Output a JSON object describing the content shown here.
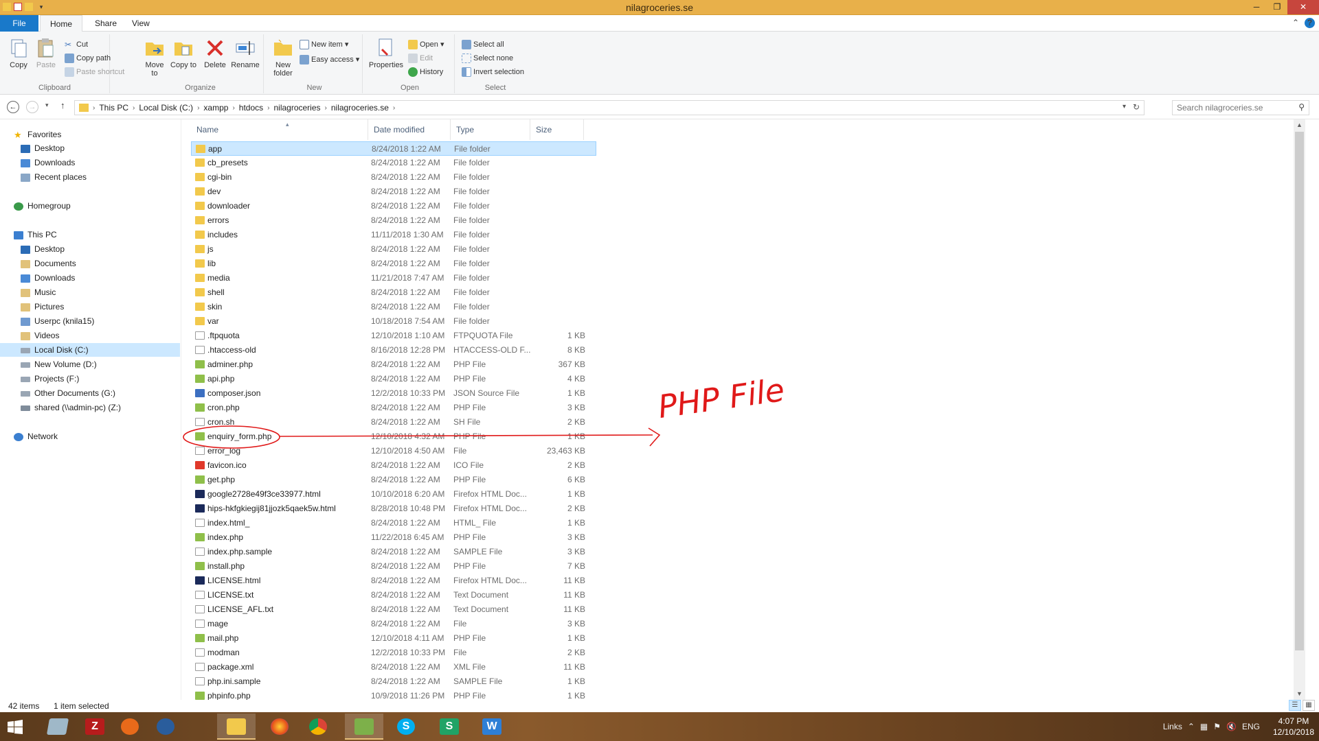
{
  "window": {
    "title": "nilagroceries.se",
    "minimize_glyph": "─",
    "restore_glyph": "❐",
    "close_glyph": "✕"
  },
  "ribbon_tabs": [
    "File",
    "Home",
    "Share",
    "View"
  ],
  "ribbon": {
    "clipboard": {
      "label": "Clipboard",
      "copy": "Copy",
      "paste": "Paste",
      "cut": "Cut",
      "copy_path": "Copy path",
      "paste_shortcut": "Paste shortcut"
    },
    "organize": {
      "label": "Organize",
      "move_to": "Move to",
      "copy_to": "Copy to",
      "delete": "Delete",
      "rename": "Rename"
    },
    "new": {
      "label": "New",
      "new_folder": "New folder",
      "new_item": "New item",
      "easy_access": "Easy access"
    },
    "open": {
      "label": "Open",
      "properties": "Properties",
      "open": "Open",
      "edit": "Edit",
      "history": "History"
    },
    "select": {
      "label": "Select",
      "select_all": "Select all",
      "select_none": "Select none",
      "invert_selection": "Invert selection"
    }
  },
  "address": {
    "crumbs": [
      "This PC",
      "Local Disk (C:)",
      "xampp",
      "htdocs",
      "nilagroceries",
      "nilagroceries.se"
    ],
    "search_placeholder": "Search nilagroceries.se"
  },
  "nav": {
    "favorites": {
      "label": "Favorites",
      "items": [
        "Desktop",
        "Downloads",
        "Recent places"
      ]
    },
    "homegroup": "Homegroup",
    "this_pc": {
      "label": "This PC",
      "items": [
        "Desktop",
        "Documents",
        "Downloads",
        "Music",
        "Pictures",
        "Userpc (knila15)",
        "Videos",
        "Local Disk (C:)",
        "New Volume (D:)",
        "Projects (F:)",
        "Other Documents (G:)",
        "shared (\\\\admin-pc) (Z:)"
      ]
    },
    "network": "Network"
  },
  "columns": {
    "name": "Name",
    "date": "Date modified",
    "type": "Type",
    "size": "Size"
  },
  "files": [
    {
      "name": "app",
      "date": "8/24/2018 1:22 AM",
      "type": "File folder",
      "size": "",
      "icon": "folder",
      "selected": true
    },
    {
      "name": "cb_presets",
      "date": "8/24/2018 1:22 AM",
      "type": "File folder",
      "size": "",
      "icon": "folder"
    },
    {
      "name": "cgi-bin",
      "date": "8/24/2018 1:22 AM",
      "type": "File folder",
      "size": "",
      "icon": "folder"
    },
    {
      "name": "dev",
      "date": "8/24/2018 1:22 AM",
      "type": "File folder",
      "size": "",
      "icon": "folder"
    },
    {
      "name": "downloader",
      "date": "8/24/2018 1:22 AM",
      "type": "File folder",
      "size": "",
      "icon": "folder"
    },
    {
      "name": "errors",
      "date": "8/24/2018 1:22 AM",
      "type": "File folder",
      "size": "",
      "icon": "folder"
    },
    {
      "name": "includes",
      "date": "11/11/2018 1:30 AM",
      "type": "File folder",
      "size": "",
      "icon": "folder"
    },
    {
      "name": "js",
      "date": "8/24/2018 1:22 AM",
      "type": "File folder",
      "size": "",
      "icon": "folder"
    },
    {
      "name": "lib",
      "date": "8/24/2018 1:22 AM",
      "type": "File folder",
      "size": "",
      "icon": "folder"
    },
    {
      "name": "media",
      "date": "11/21/2018 7:47 AM",
      "type": "File folder",
      "size": "",
      "icon": "folder"
    },
    {
      "name": "shell",
      "date": "8/24/2018 1:22 AM",
      "type": "File folder",
      "size": "",
      "icon": "folder"
    },
    {
      "name": "skin",
      "date": "8/24/2018 1:22 AM",
      "type": "File folder",
      "size": "",
      "icon": "folder"
    },
    {
      "name": "var",
      "date": "10/18/2018 7:54 AM",
      "type": "File folder",
      "size": "",
      "icon": "folder"
    },
    {
      "name": ".ftpquota",
      "date": "12/10/2018 1:10 AM",
      "type": "FTPQUOTA File",
      "size": "1 KB",
      "icon": "blank"
    },
    {
      "name": ".htaccess-old",
      "date": "8/16/2018 12:28 PM",
      "type": "HTACCESS-OLD F...",
      "size": "8 KB",
      "icon": "blank"
    },
    {
      "name": "adminer.php",
      "date": "8/24/2018 1:22 AM",
      "type": "PHP File",
      "size": "367 KB",
      "icon": "php"
    },
    {
      "name": "api.php",
      "date": "8/24/2018 1:22 AM",
      "type": "PHP File",
      "size": "4 KB",
      "icon": "php"
    },
    {
      "name": "composer.json",
      "date": "12/2/2018 10:33 PM",
      "type": "JSON Source File",
      "size": "1 KB",
      "icon": "json"
    },
    {
      "name": "cron.php",
      "date": "8/24/2018 1:22 AM",
      "type": "PHP File",
      "size": "3 KB",
      "icon": "php"
    },
    {
      "name": "cron.sh",
      "date": "8/24/2018 1:22 AM",
      "type": "SH File",
      "size": "2 KB",
      "icon": "blank"
    },
    {
      "name": "enquiry_form.php",
      "date": "12/10/2018 4:32 AM",
      "type": "PHP File",
      "size": "1 KB",
      "icon": "php"
    },
    {
      "name": "error_log",
      "date": "12/10/2018 4:50 AM",
      "type": "File",
      "size": "23,463 KB",
      "icon": "blank"
    },
    {
      "name": "favicon.ico",
      "date": "8/24/2018 1:22 AM",
      "type": "ICO File",
      "size": "2 KB",
      "icon": "ico"
    },
    {
      "name": "get.php",
      "date": "8/24/2018 1:22 AM",
      "type": "PHP File",
      "size": "6 KB",
      "icon": "php"
    },
    {
      "name": "google2728e49f3ce33977.html",
      "date": "10/10/2018 6:20 AM",
      "type": "Firefox HTML Doc...",
      "size": "1 KB",
      "icon": "html"
    },
    {
      "name": "hips-hkfgkiegij81jjozk5qaek5w.html",
      "date": "8/28/2018 10:48 PM",
      "type": "Firefox HTML Doc...",
      "size": "2 KB",
      "icon": "html"
    },
    {
      "name": "index.html_",
      "date": "8/24/2018 1:22 AM",
      "type": "HTML_ File",
      "size": "1 KB",
      "icon": "blank"
    },
    {
      "name": "index.php",
      "date": "11/22/2018 6:45 AM",
      "type": "PHP File",
      "size": "3 KB",
      "icon": "php"
    },
    {
      "name": "index.php.sample",
      "date": "8/24/2018 1:22 AM",
      "type": "SAMPLE File",
      "size": "3 KB",
      "icon": "blank"
    },
    {
      "name": "install.php",
      "date": "8/24/2018 1:22 AM",
      "type": "PHP File",
      "size": "7 KB",
      "icon": "php"
    },
    {
      "name": "LICENSE.html",
      "date": "8/24/2018 1:22 AM",
      "type": "Firefox HTML Doc...",
      "size": "11 KB",
      "icon": "html"
    },
    {
      "name": "LICENSE.txt",
      "date": "8/24/2018 1:22 AM",
      "type": "Text Document",
      "size": "11 KB",
      "icon": "blank"
    },
    {
      "name": "LICENSE_AFL.txt",
      "date": "8/24/2018 1:22 AM",
      "type": "Text Document",
      "size": "11 KB",
      "icon": "blank"
    },
    {
      "name": "mage",
      "date": "8/24/2018 1:22 AM",
      "type": "File",
      "size": "3 KB",
      "icon": "blank"
    },
    {
      "name": "mail.php",
      "date": "12/10/2018 4:11 AM",
      "type": "PHP File",
      "size": "1 KB",
      "icon": "php"
    },
    {
      "name": "modman",
      "date": "12/2/2018 10:33 PM",
      "type": "File",
      "size": "2 KB",
      "icon": "blank"
    },
    {
      "name": "package.xml",
      "date": "8/24/2018 1:22 AM",
      "type": "XML File",
      "size": "11 KB",
      "icon": "blank"
    },
    {
      "name": "php.ini.sample",
      "date": "8/24/2018 1:22 AM",
      "type": "SAMPLE File",
      "size": "1 KB",
      "icon": "blank"
    },
    {
      "name": "phpinfo.php",
      "date": "10/9/2018 11:26 PM",
      "type": "PHP File",
      "size": "1 KB",
      "icon": "php"
    }
  ],
  "status": {
    "items": "42 items",
    "selected": "1 item selected"
  },
  "annotation": {
    "text": "PHP File",
    "color": "#e01919"
  },
  "taskbar": {
    "apps": [
      "explorer-old",
      "filezilla",
      "scratch",
      "outlook",
      "file-explorer",
      "firefox",
      "chrome",
      "greenshot",
      "skype",
      "sheets",
      "word"
    ],
    "tray": {
      "links": "Links",
      "lang": "ENG",
      "time": "4:07 PM",
      "date": "12/10/2018"
    }
  },
  "colors": {
    "title_bar": "#e8b04a",
    "accent": "#1979ca",
    "selection": "#cce8ff",
    "folder": "#f2c94c"
  }
}
